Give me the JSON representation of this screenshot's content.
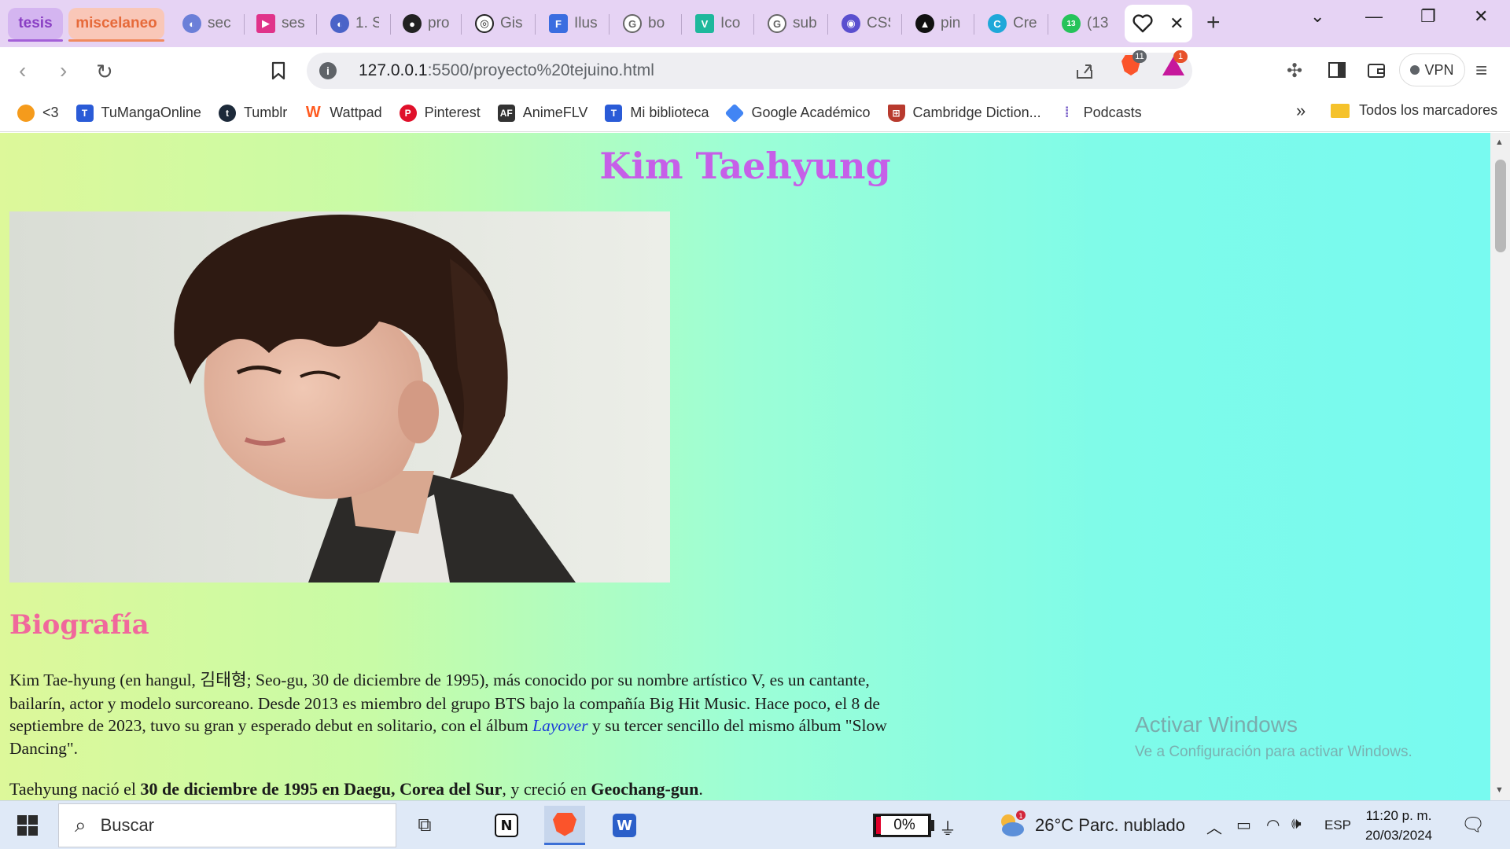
{
  "browser": {
    "tab_groups": [
      {
        "label": "tesis",
        "color": "#a35fd8"
      },
      {
        "label": "miscelaneo",
        "color": "#f08a5f"
      }
    ],
    "tabs": [
      {
        "title": "sec",
        "icon": "globe-icon"
      },
      {
        "title": "ses",
        "icon": "play-icon"
      },
      {
        "title": "1. S",
        "icon": "globe-icon"
      },
      {
        "title": "pro",
        "icon": "github-icon"
      },
      {
        "title": "Gis",
        "icon": "target-icon"
      },
      {
        "title": "Ilus",
        "icon": "doc-icon"
      },
      {
        "title": "bo",
        "icon": "google-icon"
      },
      {
        "title": "Ico",
        "icon": "vuetify-icon"
      },
      {
        "title": "sub",
        "icon": "google-icon"
      },
      {
        "title": "CSS",
        "icon": "owl-icon"
      },
      {
        "title": "pin",
        "icon": "triangle-icon"
      },
      {
        "title": "Cre",
        "icon": "canva-icon"
      },
      {
        "title": "(13",
        "icon": "whatsapp-icon"
      }
    ],
    "active_tab_icon": "heart-icon",
    "url_host": "127.0.0.1",
    "url_path": ":5500/proyecto%20tejuino.html",
    "brave_shield_count": "11",
    "rewards_count": "1",
    "vpn_label": "VPN",
    "bookmarks": [
      {
        "label": "<3",
        "icon": "orange-icon",
        "color": "#f59b1c"
      },
      {
        "label": "TuMangaOnline",
        "icon": "tmo-icon",
        "color": "#2a5bd7"
      },
      {
        "label": "Tumblr",
        "icon": "tumblr-icon",
        "color": "#1d2a3a"
      },
      {
        "label": "Wattpad",
        "icon": "wattpad-icon",
        "color": "#ff5a1f"
      },
      {
        "label": "Pinterest",
        "icon": "pinterest-icon",
        "color": "#e0102a"
      },
      {
        "label": "AnimeFLV",
        "icon": "animeflv-icon",
        "color": "#333333"
      },
      {
        "label": "Mi biblioteca",
        "icon": "tmo-icon",
        "color": "#2a5bd7"
      },
      {
        "label": "Google Académico",
        "icon": "scholar-icon",
        "color": "#4285f4"
      },
      {
        "label": "Cambridge Diction...",
        "icon": "cambridge-icon",
        "color": "#b83a2e"
      },
      {
        "label": "Podcasts",
        "icon": "podcasts-icon",
        "color": "#7b61c8"
      }
    ],
    "all_bookmarks_label": "Todos los marcadores",
    "more_label": "»"
  },
  "page": {
    "title": "Kim Taehyung",
    "bio_heading": "Biografía",
    "para1_a": "Kim Tae-hyung (en hangul, ",
    "para1_hangul": "김태형",
    "para1_b": "; Seo-gu, 30 de diciembre de 1995), más conocido por su nombre artístico V, es un cantante, bailarín, actor y modelo surcoreano. Desde 2013 es miembro del grupo BTS bajo la compañía Big Hit Music. Hace poco, el 8 de septiembre de 2023, tuvo su gran y esperado debut en solitario, con el álbum ",
    "para1_album": "Layover",
    "para1_c": " y su tercer sencillo del mismo álbum \"Slow Dancing\".",
    "para2_a": "Taehyung nació el ",
    "para2_bold1": "30 de diciembre de 1995 en Daegu, Corea del Sur",
    "para2_b": ", y creció en ",
    "para2_bold2": "Geochang-gun",
    "para2_c": "."
  },
  "watermark": {
    "line1": "Activar Windows",
    "line2": "Ve a Configuración para activar Windows."
  },
  "taskbar": {
    "search_placeholder": "Buscar",
    "battery_percent": "0%",
    "weather": "26°C  Parc. nublado",
    "weather_badge": "1",
    "language": "ESP",
    "time": "11:20 p. m.",
    "date": "20/03/2024"
  }
}
